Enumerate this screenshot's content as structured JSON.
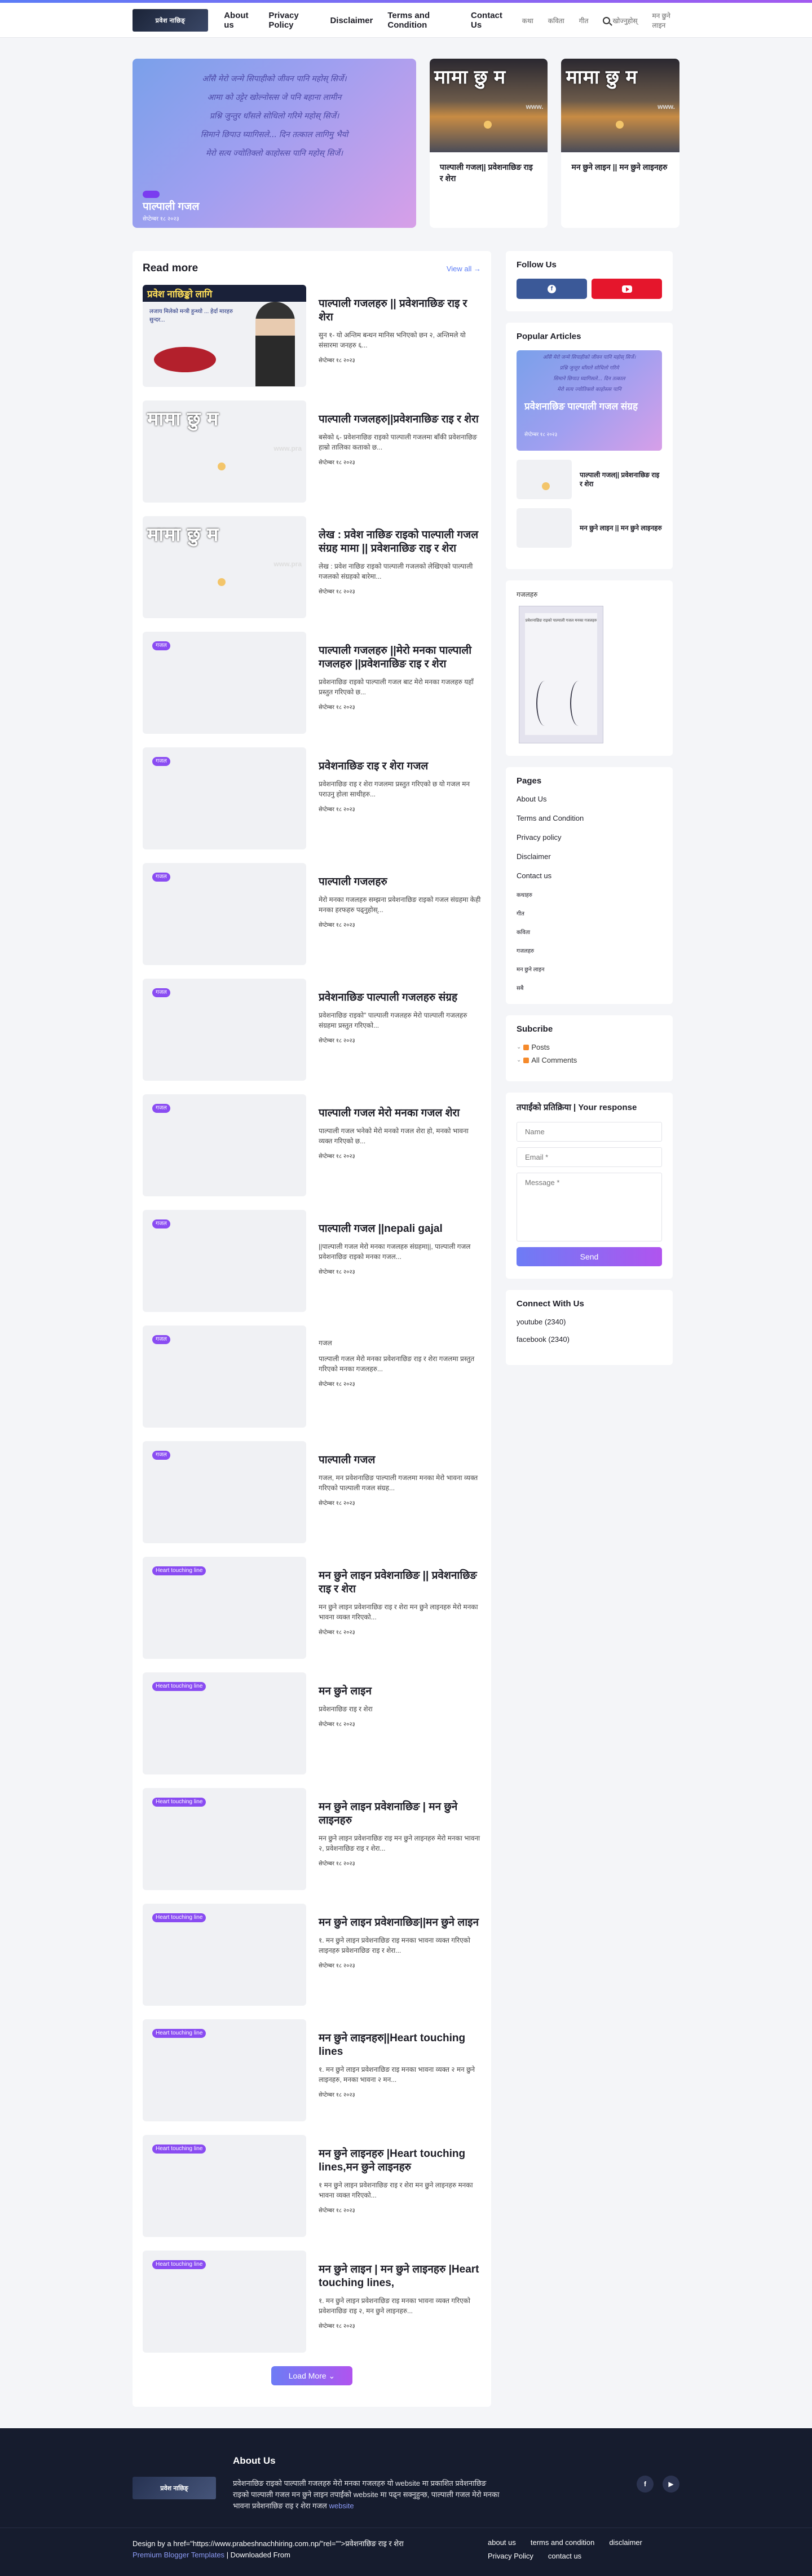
{
  "header": {
    "logo_text": "प्रवेश नाछिङ्",
    "nav": [
      "About us",
      "Privacy Policy",
      "Disclaimer",
      "Terms and Condition",
      "Contact Us"
    ],
    "nav_small": [
      "कथा",
      "कविता",
      "गीत"
    ],
    "search_label": "खोज्नुहोस्",
    "nav_last": "मन छुने लाइन"
  },
  "hero": {
    "big": {
      "lines": [
        "आँसै मेरो जन्मे सिपाहीको जीवन पानि महोस् सिर्जे।",
        "आमा को उट्टेर खोल्नोस्त्स जे पनि बहाना लामीन",
        "प्रश्नि जुन्तुर धाँसले सोधिलो गरिमे महोस् सिर्जे।",
        "सिमाने छिपाउ घ्यागिसले... दिन तत्काल लागिमु भैयो",
        "मेरो सत्य ज्योतिक्लो काहोस्त्स पानि महोस् सिर्जे।"
      ],
      "title": "पाल्पाली गजल",
      "date": "सेप्टेम्बर १८ २०२३"
    },
    "small": [
      {
        "overlay": "मामा छु म",
        "watermark": "www.",
        "title": "पाल्पाली गजल|| प्रवेशनाछिङ राइ र शेरा"
      },
      {
        "overlay": "मामा छु म",
        "watermark": "www.",
        "title": "मन छुने लाइन || मन छुने लाइनहरु"
      }
    ]
  },
  "read_more": {
    "heading": "Read more",
    "view_all": "View all",
    "load_more": "Load More"
  },
  "posts": [
    {
      "cat": "",
      "title": "पाल्पाली गजलहरु || प्रवेशनाछिङ राइ र शेरा",
      "excerpt": "सुन १- यो अन्तिम बन्धन मानिस भनिएको छन २, अन्तिमले यो संसारमा जनहरु ६...",
      "date": "सेप्टेम्बर १८ २०२३",
      "thumb": "poster",
      "banner": "प्रवेश नाछिङ्को लागि",
      "poster_text": "लजाय मिलेको मन्त्री हुन्थ्यो ... हेर्दा मारहरु सुन्दर..."
    },
    {
      "cat": "",
      "title": "पाल्पाली गजलहरु||प्रवेशनाछिङ राइ र शेरा",
      "excerpt": "बसेको ६- प्रवेशनाछिङ राइको पाल्पाली गजलमा बाँकी प्रवेशनाछिङ हाम्रो तालिका कताको छ...",
      "date": "सेप्टेम्बर १८ २०२३",
      "thumb": "photo",
      "overlay": "मामा छु म",
      "watermark": "www.pra"
    },
    {
      "cat": "",
      "title": "लेख : प्रवेश नाछिङ राइको पाल्पाली गजल संग्रह मामा || प्रवेशनाछिङ राइ र शेरा",
      "excerpt": "लेख : प्रवेश नाछिङ राइको पाल्पाली गजलको लेखिएको पाल्पाली गजलको संग्रहको बारेमा...",
      "date": "सेप्टेम्बर १८ २०२३",
      "thumb": "photo",
      "overlay": "मामा छु म",
      "watermark": "www.pra"
    },
    {
      "cat": "गजल",
      "title": "पाल्पाली गजलहरु ||मेरो मनका पाल्पाली गजलहरु ||प्रवेशनाछिङ राइ र शेरा",
      "excerpt": "प्रवेशनाछिङ राइको पाल्पाली गजल बाट मेरो मनका गजलहरु यहाँ प्रस्तुत गरिएको छ...",
      "date": "सेप्टेम्बर १८ २०२३",
      "thumb": "blank"
    },
    {
      "cat": "गजल",
      "title": "प्रवेशनाछिङ राइ र शेरा गजल",
      "excerpt": "प्रवेशनाछिङ राइ र शेरा गजलमा प्रस्तुत गरिएको छ यो गजल मन पराउनु होला साथीहरु...",
      "date": "सेप्टेम्बर १८ २०२३",
      "thumb": "blank"
    },
    {
      "cat": "गजल",
      "title": "पाल्पाली गजलहरु",
      "excerpt": "मेरो मनका गजलहरु सम्झना प्रवेशनाछिङ राइको गजल संग्रहमा केही मनका हरफहरु पढ्नुहोस्...",
      "date": "सेप्टेम्बर १८ २०२३",
      "thumb": "blank"
    },
    {
      "cat": "गजल",
      "title": "प्रवेशनाछिङ पाल्पाली गजलहरु संग्रह",
      "excerpt": "प्रवेशनाछिङ राइको\" पाल्पाली गजलहरु मेरो पाल्पाली गजलहरु संग्रहमा प्रस्तुत गरिएको...",
      "date": "सेप्टेम्बर १८ २०२३",
      "thumb": "blank"
    },
    {
      "cat": "गजल",
      "title": "पाल्पाली गजल मेरो मनका गजल शेरा",
      "excerpt": "पाल्पाली गजल भनेको मेरो मनको गजल शेरा हो, मनको भावना व्यक्त गरिएको छ...",
      "date": "सेप्टेम्बर १८ २०२३",
      "thumb": "blank"
    },
    {
      "cat": "गजल",
      "title": "पाल्पाली गजल ||nepali gajal",
      "excerpt": "||पाल्पाली गजल मेरो मनका गजलहरु संग्रहमा||, पाल्पाली गजल प्रवेशनाछिङ राइको मनका गजल...",
      "date": "सेप्टेम्बर १८ २०२३",
      "thumb": "blank"
    },
    {
      "cat": "गजल",
      "title": "",
      "label": "गजल",
      "excerpt": "पाल्पाली गजल मेरो मनका प्रवेशनाछिङ राइ र शेरा गजलमा प्रस्तुत गरिएको मनका गजलहरु...",
      "date": "सेप्टेम्बर १८ २०२३",
      "thumb": "blank"
    },
    {
      "cat": "गजल",
      "title": "पाल्पाली गजल",
      "excerpt": "गजल, मन प्रवेशनाछिङ पाल्पाली गजलमा मनका मेरो भावना व्यक्त गरिएको पाल्पाली गजल संग्रह...",
      "date": "सेप्टेम्बर १८ २०२३",
      "thumb": "blank"
    },
    {
      "cat": "Heart touching line",
      "title": "मन छुने लाइन प्रवेशनाछिङ || प्रवेशनाछिङ राइ र शेरा",
      "excerpt": "मन छुने लाइन प्रवेशनाछिङ राइ र शेरा मन छुने लाइनहरु मेरो मनका भावना व्यक्त गरिएको...",
      "date": "सेप्टेम्बर १८ २०२३",
      "thumb": "blank"
    },
    {
      "cat": "Heart touching line",
      "title": "मन छुने लाइन",
      "excerpt": "प्रवेशनाछिङ राइ र शेरा",
      "date": "सेप्टेम्बर १८ २०२३",
      "thumb": "blank"
    },
    {
      "cat": "Heart touching line",
      "title": "मन छुने लाइन प्रवेशनाछिङ | मन छुने लाइनहरु",
      "excerpt": "मन छुने लाइन प्रवेशनाछिङ राइ मन छुने लाइनहरु मेरो मनका भावना २, प्रवेशनाछिङ राइ र शेरा...",
      "date": "सेप्टेम्बर १८ २०२३",
      "thumb": "blank"
    },
    {
      "cat": "Heart touching line",
      "title": "मन छुने लाइन प्रवेशनाछिङ||मन छुने लाइन",
      "excerpt": "१. मन छुने लाइन प्रवेशनाछिङ राइ मनका भावना व्यक्त गरिएको लाइनहरु प्रवेशनाछिङ राइ र शेरा...",
      "date": "सेप्टेम्बर १८ २०२३",
      "thumb": "blank"
    },
    {
      "cat": "Heart touching line",
      "title": "मन छुने लाइनहरु||Heart touching lines",
      "excerpt": "१. मन छुने लाइन प्रवेशनाछिङ राइ मनका भावना व्यक्त २ मन छुने लाइनहरु, मनका भावना २ मन...",
      "date": "सेप्टेम्बर १८ २०२३",
      "thumb": "blank"
    },
    {
      "cat": "Heart touching line",
      "title": "मन छुने लाइनहरु |Heart touching lines,मन छुने लाइनहरु",
      "excerpt": "१ मन छुने लाइन प्रवेशनाछिङ राइ र शेरा मन छुने लाइनहरु मनका भावना व्यक्त गरिएको...",
      "date": "सेप्टेम्बर १८ २०२३",
      "thumb": "blank"
    },
    {
      "cat": "Heart touching line",
      "title": "मन छुने लाइन | मन छुने लाइनहरु |Heart touching lines,",
      "excerpt": "१. मन छुने लाइन प्रवेशनाछिङ राइ मनका भावना व्यक्त गरिएको प्रवेशनाछिङ राइ २, मन छुने लाइनहरु...",
      "date": "सेप्टेम्बर १८ २०२३",
      "thumb": "blank"
    }
  ],
  "sidebar": {
    "follow": {
      "title": "Follow Us"
    },
    "popular": {
      "title": "Popular Articles",
      "big_lines": [
        "आँसै मेरो जन्मे सिपाहीको जीवन पानि महोस् सिर्जे।",
        "प्रश्नि जुन्तुर धाँसले सोधिलो गरिमे",
        "सिमाने छिपाउ घ्यागिसले... दिन तत्काल",
        "मेरो सत्य ज्योतिक्लो काहोस्त्स पानि"
      ],
      "big_title": "प्रवेशनाछिङ पाल्पाली गजल संग्रह",
      "big_date": "सेप्टेम्बर १८ २०२३",
      "items": [
        {
          "title": "पाल्पाली गजल|| प्रवेशनाछिङ राइ र शेरा",
          "thumb": "photo"
        },
        {
          "title": "मन छुने लाइन || मन छुने लाइनहरु",
          "thumb": "blank"
        }
      ]
    },
    "image_widget": {
      "label": "गजलहरु",
      "card_text": "प्रवेशनाछिङ राइको पाल्पाली गजल मनका गजलहरु"
    },
    "pages": {
      "title": "Pages",
      "links": [
        "About Us",
        "Terms and Condition",
        "Privacy policy",
        "Disclaimer",
        "Contact us"
      ],
      "small_links": [
        "कथाहरु",
        "गीत",
        "कविता",
        "गजलहरु",
        "मन छुने लाइन",
        "सबै"
      ]
    },
    "subscribe": {
      "title": "Subcribe",
      "items": [
        "Posts",
        "All Comments"
      ]
    },
    "contact": {
      "title": "तपाईंको प्रतिक्रिया | Your response",
      "name_ph": "Name",
      "email_ph": "Email *",
      "message_ph": "Message *",
      "send": "Send"
    },
    "connect": {
      "title": "Connect With Us",
      "links": [
        "youtube (2340)",
        "facebook (2340)"
      ]
    }
  },
  "footer": {
    "logo_text": "प्रवेश नाछिङ्",
    "about_title": "About Us",
    "about_text": "प्रवेशनाछिङ राइको पाल्पाली गजलहरु मेरो मनका गजलहरु यो website मा प्रकाशित प्रवेशनाछिङ राइको पाल्पाली गजल मन छुने लाइन तपाईंको website मा पढ्न सक्नुहुन्छ, पाल्पाली गजल मेरो मनका भावना प्रवेशनाछिङ राइ र शेरा गजल",
    "about_link": "website",
    "credit_prefix": "Design by a href=\"https://www.prabeshnachhiring.com.np/\"rel=\"\">प्रवेशनाछिङ राइ र शेरा",
    "credit_link": "Premium Blogger Templates",
    "credit_suffix": "| Downloaded From",
    "links": [
      "about us",
      "terms and condition",
      "disclaimer",
      "Privacy Policy",
      "contact us"
    ]
  }
}
